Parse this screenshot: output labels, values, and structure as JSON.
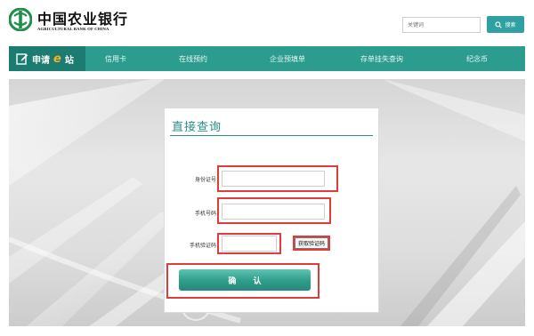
{
  "header": {
    "bank_name_cn": "中国农业银行",
    "bank_name_en": "AGRICULTURAL BANK OF CHINA",
    "search_placeholder": "关键词",
    "search_button": "搜索"
  },
  "nav": {
    "brand_prefix": "申请",
    "brand_mark": "e",
    "brand_suffix": "站",
    "items": [
      {
        "label": "信用卡"
      },
      {
        "label": "在线预约"
      },
      {
        "label": "企业预填单"
      },
      {
        "label": "存单挂失查询"
      },
      {
        "label": "纪念币"
      }
    ]
  },
  "form": {
    "title": "直接查询",
    "id_label": "身份证号：",
    "phone_label": "手机号码：",
    "code_label": "手机验证码：",
    "id_value": "",
    "phone_value": "",
    "code_value": "",
    "sms_button": "获取验证码",
    "confirm_button": "确 认"
  },
  "colors": {
    "brand_teal": "#2c9c8e",
    "brand_dark": "#1d7c72",
    "highlight_red": "#e23b3b",
    "e_accent": "#f2b31c"
  }
}
